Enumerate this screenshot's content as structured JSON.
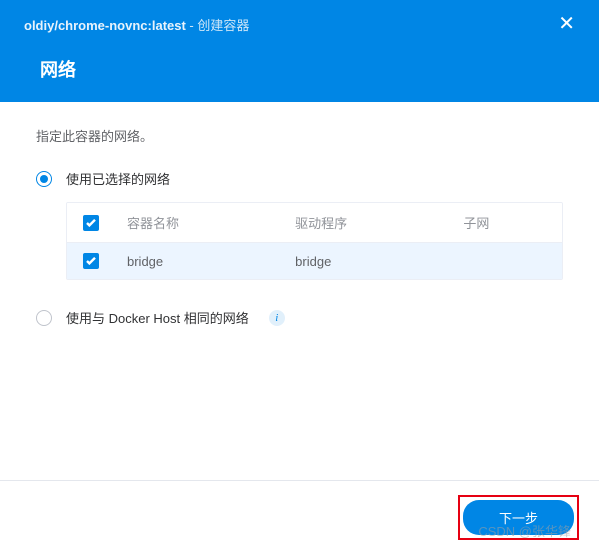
{
  "header": {
    "image_title": "oldiy/chrome-novnc:latest",
    "separator": " - ",
    "action": "创建容器",
    "section_title": "网络"
  },
  "instruction": "指定此容器的网络。",
  "option1": {
    "label": "使用已选择的网络"
  },
  "option2": {
    "label": "使用与 Docker Host 相同的网络"
  },
  "table": {
    "headers": {
      "name": "容器名称",
      "driver": "驱动程序",
      "subnet": "子网"
    },
    "rows": [
      {
        "name": "bridge",
        "driver": "bridge",
        "subnet": ""
      }
    ]
  },
  "footer": {
    "next": "下一步"
  },
  "watermark": "CSDN @张华锋"
}
